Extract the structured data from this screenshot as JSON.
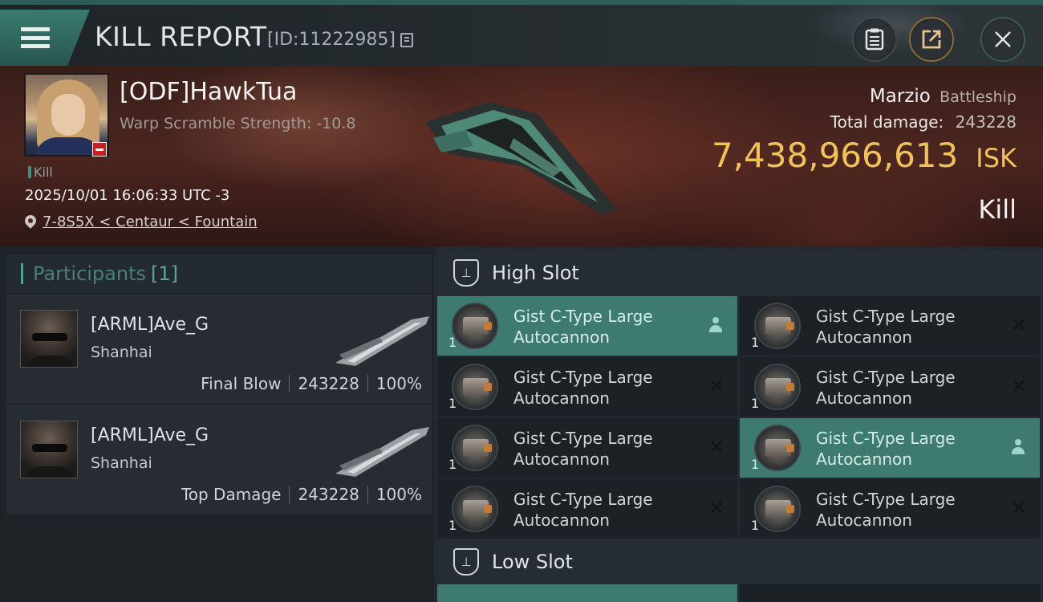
{
  "header": {
    "title": "KILL REPORT",
    "id_label": "[ID:11222985]"
  },
  "victim": {
    "name": "[ODF]HawkTua",
    "scramble": "Warp Scramble Strength: -10.8",
    "kill_tag": "Kill",
    "timestamp": "2025/10/01 16:06:33 UTC -3",
    "location": "7-8S5X < Centaur < Fountain",
    "ship_name": "Marzio",
    "ship_class": "Battleship",
    "total_damage_label": "Total damage:",
    "total_damage": "243228",
    "isk_value": "7,438,966,613",
    "isk_unit": "ISK",
    "result": "Kill"
  },
  "participants": {
    "title": "Participants",
    "count": "[1]",
    "rows": [
      {
        "name": "[ARML]Ave_G",
        "ship": "Shanhai",
        "role": "Final Blow",
        "damage": "243228",
        "percent": "100%"
      },
      {
        "name": "[ARML]Ave_G",
        "ship": "Shanhai",
        "role": "Top Damage",
        "damage": "243228",
        "percent": "100%"
      }
    ]
  },
  "slots": {
    "high_title": "High Slot",
    "low_title": "Low Slot",
    "high_modules": [
      {
        "qty": "1",
        "name_line1": "Gist C-Type Large",
        "name_line2": "Autocannon",
        "status": "dropped"
      },
      {
        "qty": "1",
        "name_line1": "Gist C-Type Large",
        "name_line2": "Autocannon",
        "status": "destroyed"
      },
      {
        "qty": "1",
        "name_line1": "Gist C-Type Large",
        "name_line2": "Autocannon",
        "status": "destroyed"
      },
      {
        "qty": "1",
        "name_line1": "Gist C-Type Large",
        "name_line2": "Autocannon",
        "status": "destroyed"
      },
      {
        "qty": "1",
        "name_line1": "Gist C-Type Large",
        "name_line2": "Autocannon",
        "status": "destroyed"
      },
      {
        "qty": "1",
        "name_line1": "Gist C-Type Large",
        "name_line2": "Autocannon",
        "status": "dropped"
      },
      {
        "qty": "1",
        "name_line1": "Gist C-Type Large",
        "name_line2": "Autocannon",
        "status": "destroyed"
      },
      {
        "qty": "1",
        "name_line1": "Gist C-Type Large",
        "name_line2": "Autocannon",
        "status": "destroyed"
      }
    ]
  },
  "colors": {
    "accent_teal": "#3d7b71",
    "isk_gold": "#f0c25a",
    "banner_red": "#4b2520"
  },
  "icons": [
    "menu-icon",
    "copy-icon",
    "clipboard-icon",
    "share-icon",
    "close-icon",
    "location-pin-icon",
    "high-slot-icon",
    "low-slot-icon",
    "person-icon",
    "close-x-icon"
  ]
}
